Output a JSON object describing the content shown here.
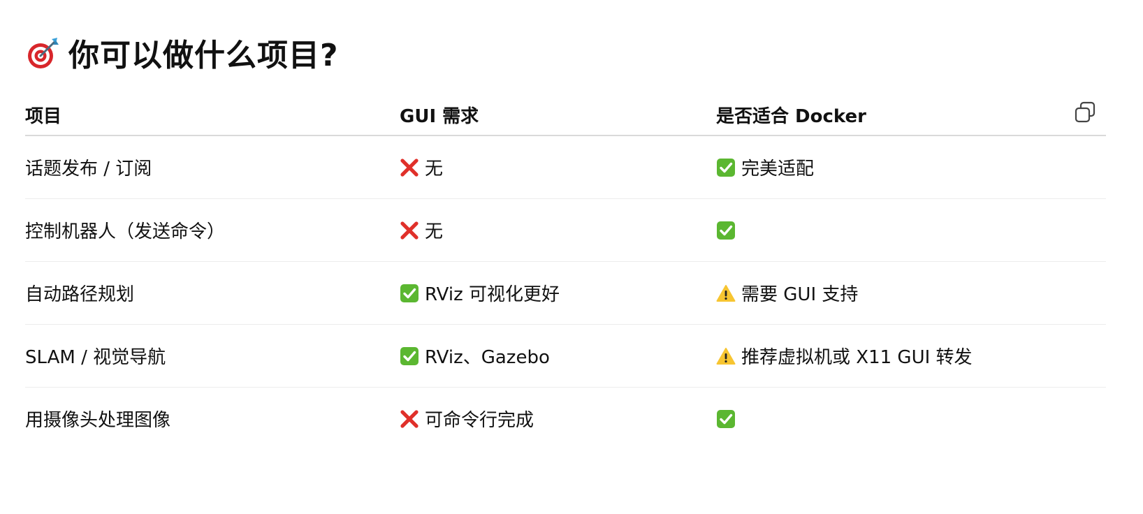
{
  "heading": {
    "icon": "target-dart-icon",
    "title": "你可以做什么项目?"
  },
  "table": {
    "headers": [
      "项目",
      "GUI 需求",
      "是否适合 Docker"
    ],
    "copy_icon": "copy-icon",
    "rows": [
      {
        "project": "话题发布 / 订阅",
        "gui": {
          "icon": "cross-mark-icon",
          "text": "无"
        },
        "docker": {
          "icon": "check-mark-icon",
          "text": "完美适配"
        }
      },
      {
        "project": "控制机器人（发送命令）",
        "gui": {
          "icon": "cross-mark-icon",
          "text": "无"
        },
        "docker": {
          "icon": "check-mark-icon",
          "text": ""
        }
      },
      {
        "project": "自动路径规划",
        "gui": {
          "icon": "check-mark-icon",
          "text": "RViz 可视化更好"
        },
        "docker": {
          "icon": "warning-icon",
          "text": "需要 GUI 支持"
        }
      },
      {
        "project": "SLAM / 视觉导航",
        "gui": {
          "icon": "check-mark-icon",
          "text": "RViz、Gazebo"
        },
        "docker": {
          "icon": "warning-icon",
          "text": "推荐虚拟机或 X11 GUI 转发"
        }
      },
      {
        "project": "用摄像头处理图像",
        "gui": {
          "icon": "cross-mark-icon",
          "text": "可命令行完成"
        },
        "docker": {
          "icon": "check-mark-icon",
          "text": ""
        }
      }
    ]
  },
  "colors": {
    "check_green": "#5bb731",
    "cross_red": "#e0302a",
    "warning_yellow": "#f7c531",
    "header_border": "#d9d9d9",
    "row_border": "#ececec"
  }
}
